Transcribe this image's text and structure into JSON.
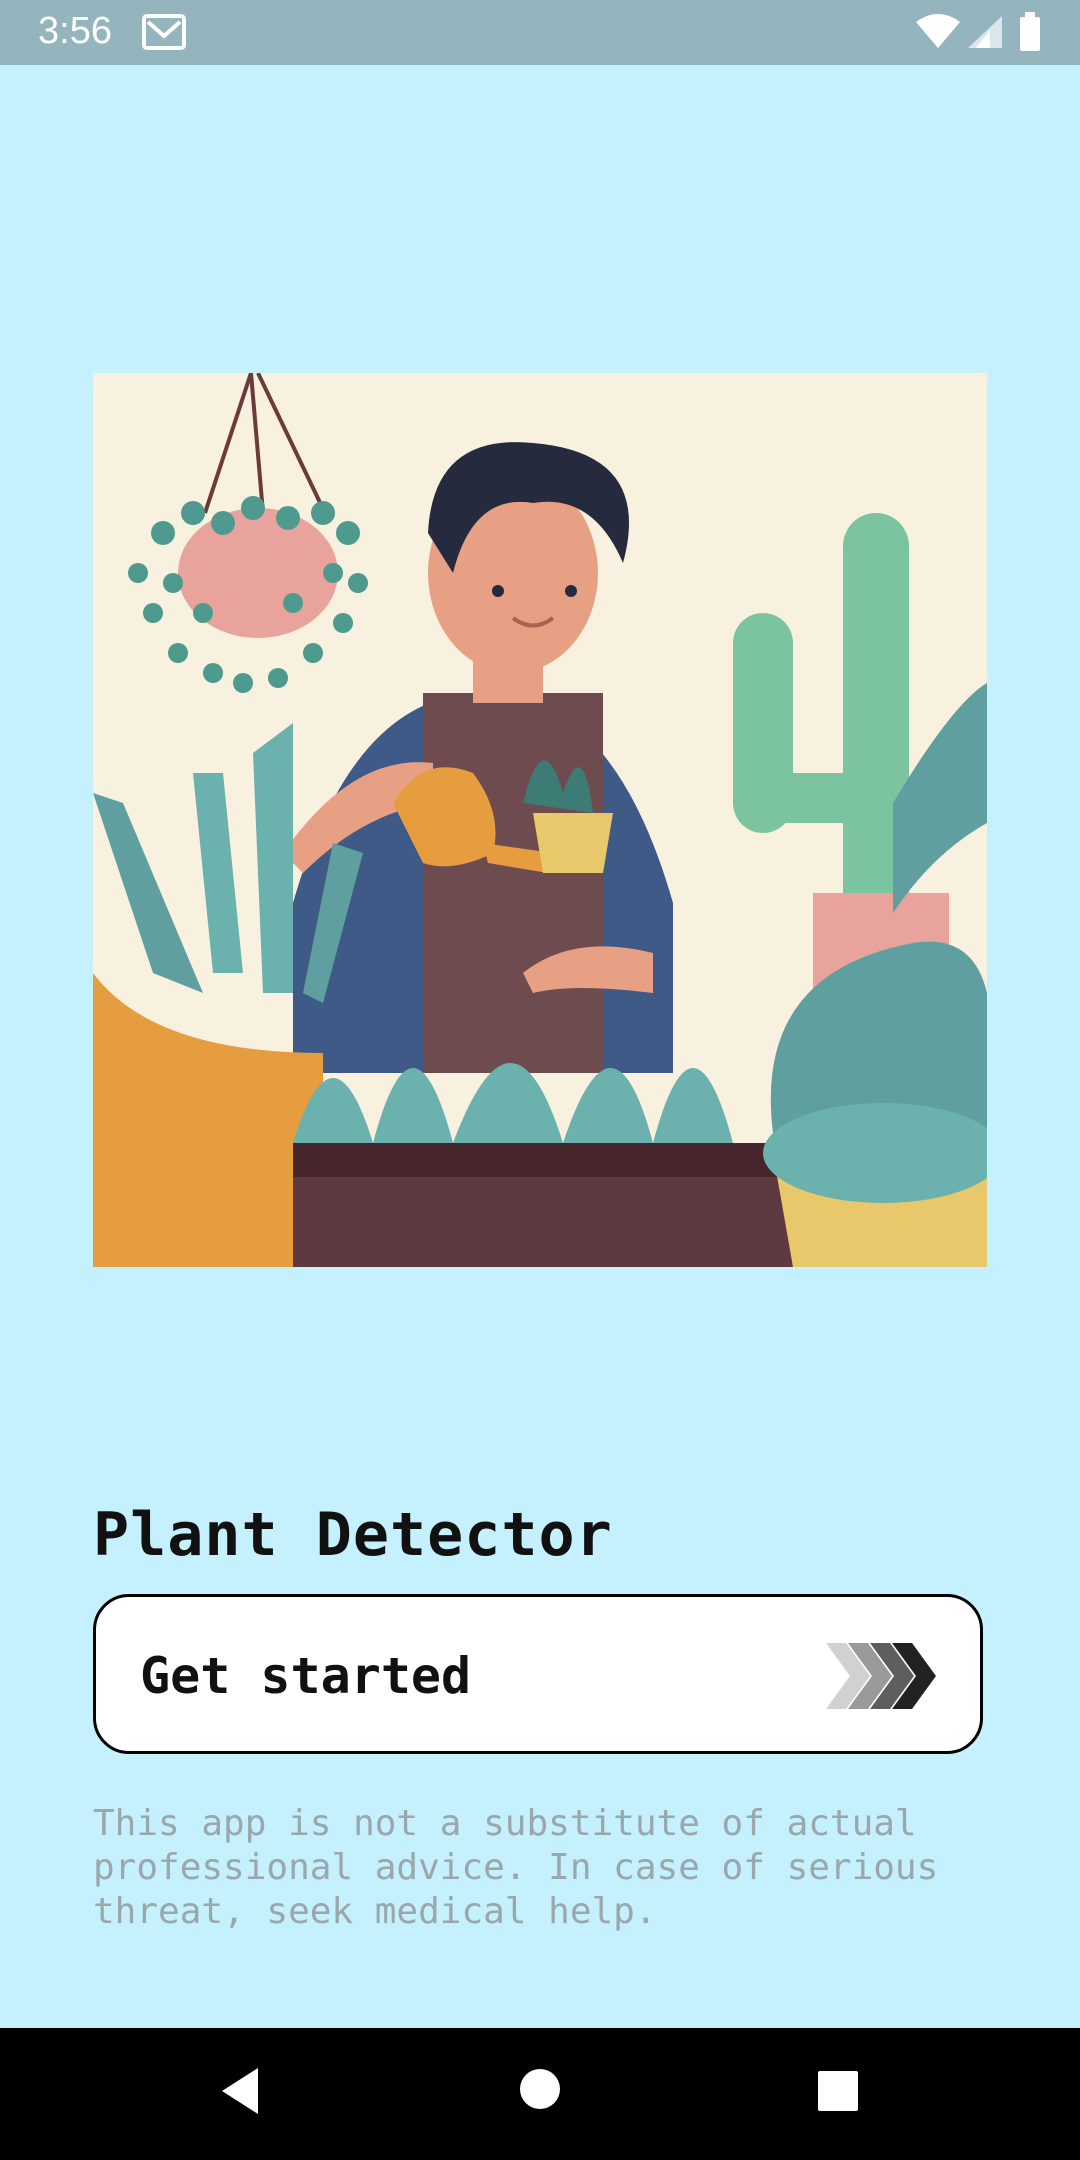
{
  "status_bar": {
    "time": "3:56",
    "icons": [
      "mail-icon",
      "wifi-icon",
      "signal-icon",
      "battery-icon"
    ]
  },
  "illustration": {
    "description_icon": "gardener-illustration"
  },
  "main": {
    "title": "Plant Detector",
    "get_started_label": "Get started",
    "disclaimer": "This app is not a substitute of actual professional advice. In case of serious threat, seek medical help."
  },
  "nav_bar": {
    "icons": [
      "back-icon",
      "home-icon",
      "recents-icon"
    ]
  },
  "colors": {
    "background": "#c4f1fd",
    "status_bar": "#94b5bd",
    "button_bg": "#ffffff",
    "disclaimer_text": "#9aa7ab"
  }
}
